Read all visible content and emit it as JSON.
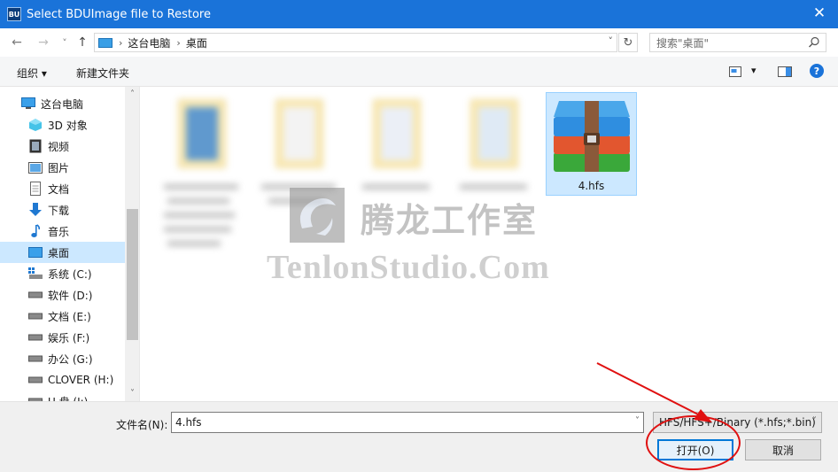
{
  "window": {
    "title": "Select BDUImage file to Restore",
    "app_icon_text": "BU",
    "close_glyph": "✕"
  },
  "nav": {
    "back_glyph": "←",
    "forward_glyph": "→",
    "recent_glyph": "˅",
    "up_glyph": "↑",
    "breadcrumb": [
      "这台电脑",
      "桌面"
    ],
    "breadcrumb_sep": "›",
    "address_dropdown_glyph": "˅",
    "refresh_glyph": "↻",
    "search_placeholder": "搜索\"桌面\""
  },
  "toolbar": {
    "organize_label": "组织 ▾",
    "new_folder_label": "新建文件夹",
    "view_dd_glyph": "▾",
    "help_glyph": "?"
  },
  "sidebar": {
    "items": [
      {
        "label": "这台电脑",
        "icon": "computer-icon"
      },
      {
        "label": "3D 对象",
        "icon": "3d-objects-icon"
      },
      {
        "label": "视频",
        "icon": "video-icon"
      },
      {
        "label": "图片",
        "icon": "pictures-icon"
      },
      {
        "label": "文档",
        "icon": "documents-icon"
      },
      {
        "label": "下载",
        "icon": "download-icon"
      },
      {
        "label": "音乐",
        "icon": "music-icon"
      },
      {
        "label": "桌面",
        "icon": "desktop-icon",
        "selected": true
      },
      {
        "label": "系统 (C:)",
        "icon": "system-drive-icon"
      },
      {
        "label": "软件 (D:)",
        "icon": "drive-icon"
      },
      {
        "label": "文档 (E:)",
        "icon": "drive-icon"
      },
      {
        "label": "娱乐 (F:)",
        "icon": "drive-icon"
      },
      {
        "label": "办公 (G:)",
        "icon": "drive-icon"
      },
      {
        "label": "CLOVER (H:)",
        "icon": "drive-icon"
      },
      {
        "label": "U 盘 (I:)",
        "icon": "drive-icon"
      }
    ],
    "scroll_up_glyph": "˄",
    "scroll_down_glyph": "˅"
  },
  "content": {
    "selected_file": {
      "name": "4.hfs",
      "icon": "winrar-archive-icon"
    },
    "watermark_cn": "腾龙工作室",
    "watermark_en": "TenlonStudio.Com"
  },
  "bottom": {
    "filename_label": "文件名(N):",
    "filename_value": "4.hfs",
    "dropdown_glyph": "˅",
    "filter_value": "HFS/HFS+/Binary (*.hfs;*.bin)",
    "open_label": "打开(O)",
    "cancel_label": "取消"
  },
  "colors": {
    "titlebar": "#1a73d9",
    "selection": "#cce8ff",
    "annotation": "#e01010"
  }
}
